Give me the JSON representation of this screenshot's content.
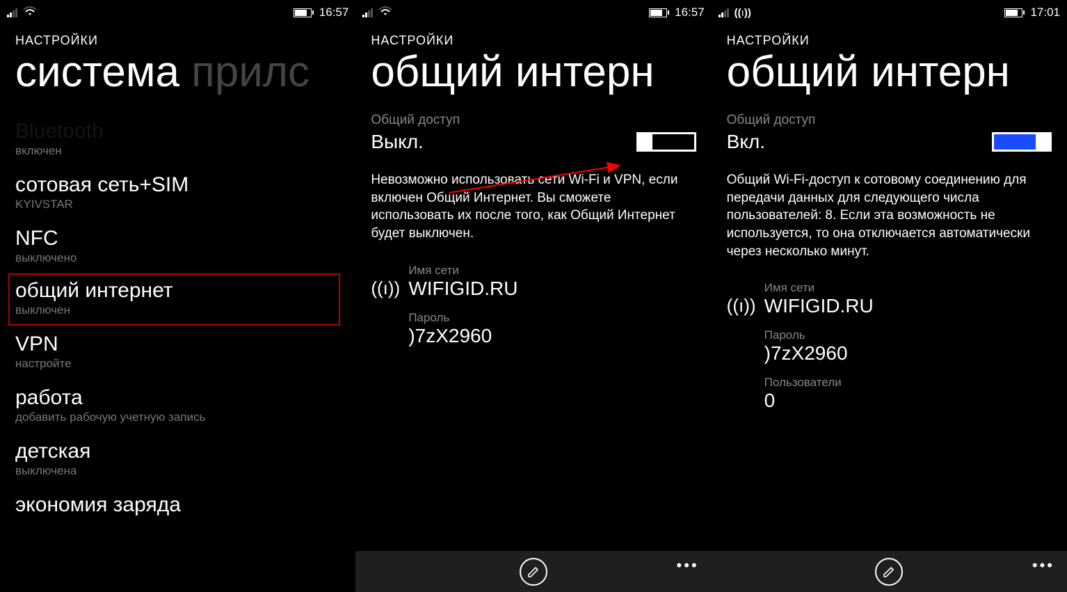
{
  "screens": [
    {
      "status": {
        "time": "16:57",
        "wifi_mode": "wifi"
      },
      "section_label": "НАСТРОЙКИ",
      "title_main": "система",
      "title_dim": " прилс",
      "list": [
        {
          "title": "",
          "sub": "включен",
          "cut": true
        },
        {
          "title": "сотовая сеть+SIM",
          "sub": "KYIVSTAR"
        },
        {
          "title": "NFC",
          "sub": "выключено"
        },
        {
          "title": "общий интернет",
          "sub": "выключен",
          "highlight": true
        },
        {
          "title": "VPN",
          "sub": "настройте"
        },
        {
          "title": "работа",
          "sub": "добавить рабочую учетную запись"
        },
        {
          "title": "детская",
          "sub": "выключена"
        },
        {
          "title": "экономия заряда",
          "sub": ""
        }
      ]
    },
    {
      "status": {
        "time": "16:57",
        "wifi_mode": "wifi"
      },
      "section_label": "НАСТРОЙКИ",
      "title_main": "общий интерн",
      "sharing_label": "Общий доступ",
      "sharing_state": "Выкл.",
      "toggle_on": false,
      "info": "Невозможно использовать сети Wi-Fi и VPN, если включен Общий Интернет. Вы сможете использовать их после того, как Общий Интернет будет выключен.",
      "network_name_label": "Имя сети",
      "network_name": "WIFIGID.RU",
      "password_label": "Пароль",
      "password": ")7zX2960",
      "arrow": true
    },
    {
      "status": {
        "time": "17:01",
        "wifi_mode": "hotspot"
      },
      "section_label": "НАСТРОЙКИ",
      "title_main": "общий интерн",
      "sharing_label": "Общий доступ",
      "sharing_state": "Вкл.",
      "toggle_on": true,
      "info": "Общий Wi-Fi-доступ к сотовому соединению для передачи данных для следующего числа пользователей: 8. Если эта возможность не используется, то она отключается автоматически через несколько минут.",
      "network_name_label": "Имя сети",
      "network_name": "WIFIGID.RU",
      "password_label": "Пароль",
      "password": ")7zX2960",
      "users_label": "Пользователи",
      "users_count": "0"
    }
  ]
}
